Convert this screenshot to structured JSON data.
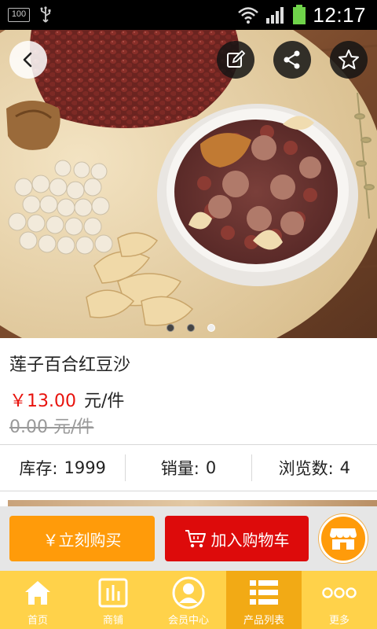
{
  "status_bar": {
    "battery_label": "100",
    "time": "12:17"
  },
  "product": {
    "title": "莲子百合红豆沙",
    "price": "￥13.00",
    "price_unit": "元/件",
    "original_price": "0.00 元/件"
  },
  "carousel": {
    "slide_count": 3,
    "active_index": 2
  },
  "stats": [
    {
      "label": "库存:",
      "value": "1999"
    },
    {
      "label": "销量:",
      "value": "0"
    },
    {
      "label": "浏览数:",
      "value": "4"
    }
  ],
  "actions": {
    "buy_now": "￥立刻购买",
    "add_to_cart": "加入购物车"
  },
  "nav": [
    {
      "label": "首页",
      "icon": "home-icon"
    },
    {
      "label": "商铺",
      "icon": "shop-icon"
    },
    {
      "label": "会员中心",
      "icon": "member-icon"
    },
    {
      "label": "产品列表",
      "icon": "list-icon"
    },
    {
      "label": "更多",
      "icon": "more-icon"
    }
  ],
  "colors": {
    "price_red": "#e8120c",
    "buy_orange": "#ff9b0a",
    "cart_red": "#dd0b0b",
    "nav_yellow": "#ffd24a",
    "nav_active": "#f2aa15"
  }
}
